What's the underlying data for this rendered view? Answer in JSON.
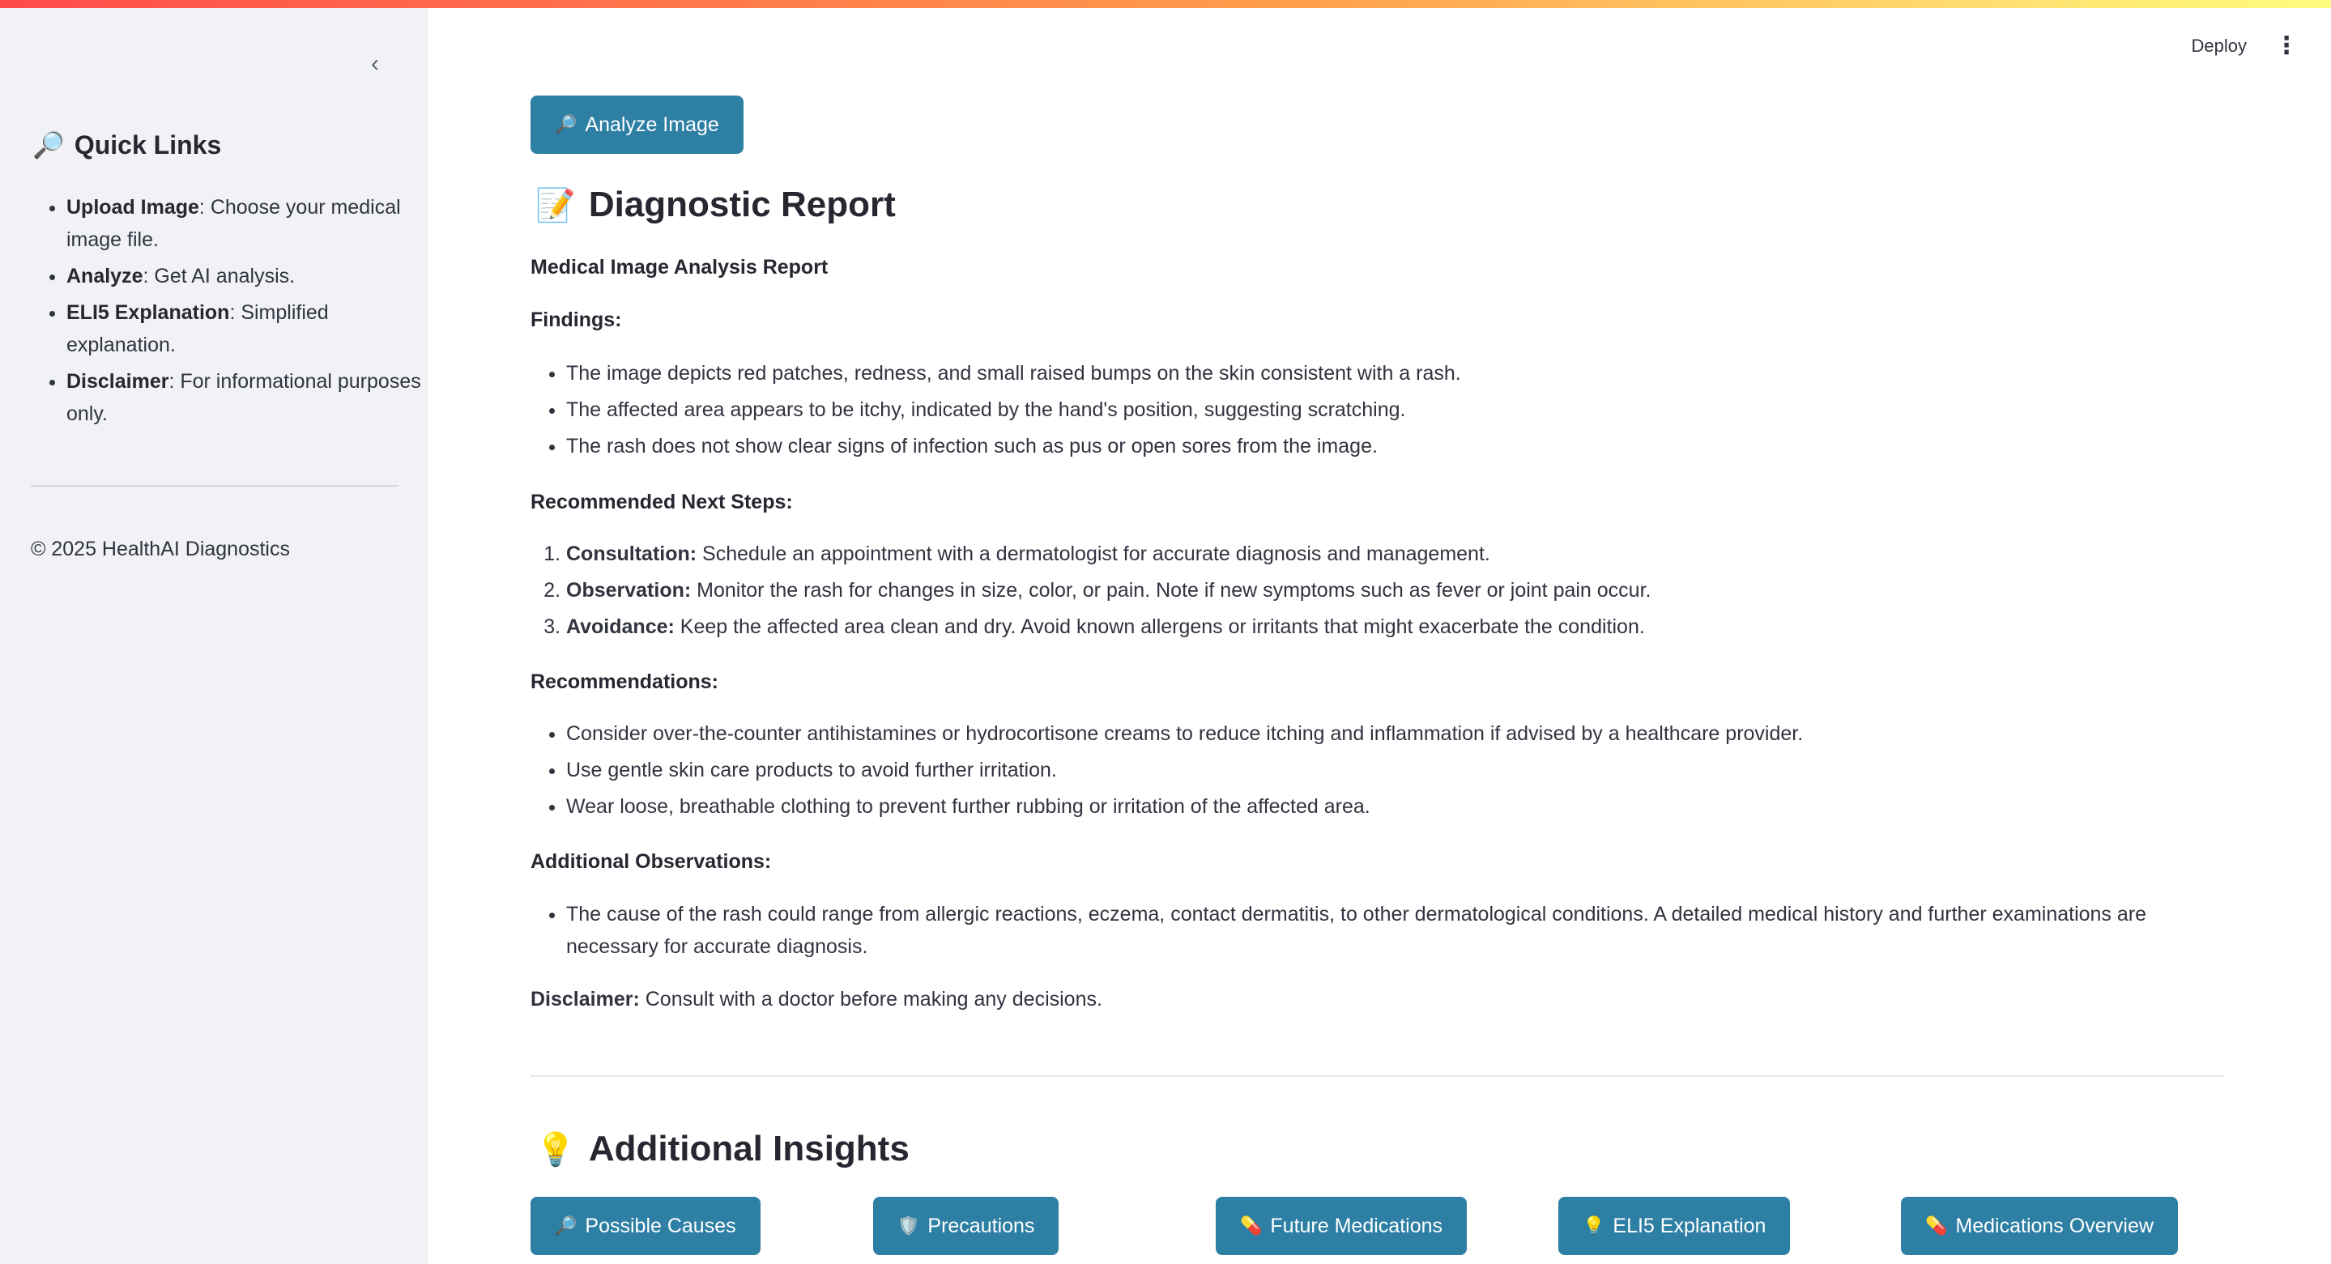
{
  "sidebar": {
    "collapse_icon": "chevron-left",
    "heading_icon": "🔎",
    "heading": "Quick Links",
    "items": [
      {
        "bold": "Upload Image",
        "text": ": Choose your medical image file."
      },
      {
        "bold": "Analyze",
        "text": ": Get AI analysis."
      },
      {
        "bold": "ELI5 Explanation",
        "text": ": Simplified explanation."
      },
      {
        "bold": "Disclaimer",
        "text": ": For informational purposes only."
      }
    ],
    "footer": "© 2025 HealthAI Diagnostics"
  },
  "header": {
    "deploy_label": "Deploy",
    "menu_icon": "⋮"
  },
  "main": {
    "analyze_button": {
      "icon": "🔎",
      "label": "Analyze Image"
    },
    "report_heading": {
      "icon": "📝",
      "text": "Diagnostic Report"
    },
    "report": {
      "title": "Medical Image Analysis Report",
      "findings_label": "Findings:",
      "findings": [
        "The image depicts red patches, redness, and small raised bumps on the skin consistent with a rash.",
        "The affected area appears to be itchy, indicated by the hand's position, suggesting scratching.",
        "The rash does not show clear signs of infection such as pus or open sores from the image."
      ],
      "next_steps_label": "Recommended Next Steps:",
      "next_steps": [
        {
          "bold": "Consultation:",
          "text": " Schedule an appointment with a dermatologist for accurate diagnosis and management."
        },
        {
          "bold": "Observation:",
          "text": " Monitor the rash for changes in size, color, or pain. Note if new symptoms such as fever or joint pain occur."
        },
        {
          "bold": "Avoidance:",
          "text": " Keep the affected area clean and dry. Avoid known allergens or irritants that might exacerbate the condition."
        }
      ],
      "recommendations_label": "Recommendations:",
      "recommendations": [
        "Consider over-the-counter antihistamines or hydrocortisone creams to reduce itching and inflammation if advised by a healthcare provider.",
        "Use gentle skin care products to avoid further irritation.",
        "Wear loose, breathable clothing to prevent further rubbing or irritation of the affected area."
      ],
      "additional_label": "Additional Observations:",
      "additional": [
        "The cause of the rash could range from allergic reactions, eczema, contact dermatitis, to other dermatological conditions. A detailed medical history and further examinations are necessary for accurate diagnosis."
      ],
      "disclaimer_bold": "Disclaimer:",
      "disclaimer_text": " Consult with a doctor before making any decisions."
    },
    "insights_heading": {
      "icon": "💡",
      "text": "Additional Insights"
    },
    "insight_buttons": [
      {
        "icon": "🔎",
        "label": "Possible Causes"
      },
      {
        "icon": "🛡️",
        "label": "Precautions"
      },
      {
        "icon": "💊",
        "label": "Future Medications"
      },
      {
        "icon": "💡",
        "label": "ELI5 Explanation"
      },
      {
        "icon": "💊",
        "label": "Medications Overview"
      }
    ]
  },
  "colors": {
    "button_bg": "#2e7fa4",
    "sidebar_bg": "#f0f2f6",
    "text": "#31333f"
  }
}
